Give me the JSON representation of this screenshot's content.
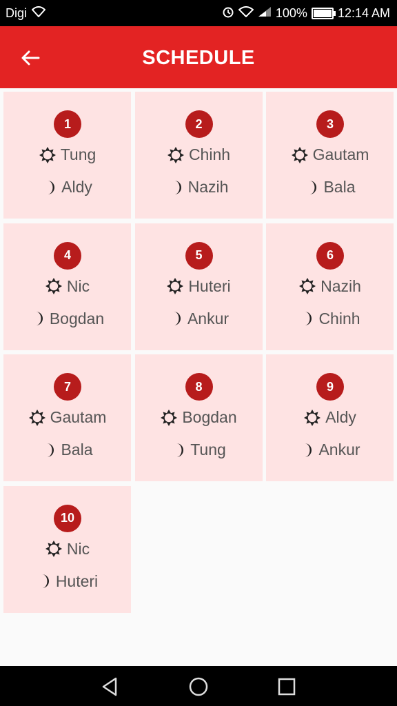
{
  "status_bar": {
    "carrier": "Digi",
    "battery": "100%",
    "time": "12:14 AM"
  },
  "header": {
    "title": "SCHEDULE",
    "back_icon": "arrow-left-icon"
  },
  "schedule": [
    {
      "number": "1",
      "day": "Tung",
      "night": "Aldy"
    },
    {
      "number": "2",
      "day": "Chinh",
      "night": "Nazih"
    },
    {
      "number": "3",
      "day": "Gautam",
      "night": "Bala"
    },
    {
      "number": "4",
      "day": "Nic",
      "night": "Bogdan"
    },
    {
      "number": "5",
      "day": "Huteri",
      "night": "Ankur"
    },
    {
      "number": "6",
      "day": "Nazih",
      "night": "Chinh"
    },
    {
      "number": "7",
      "day": "Gautam",
      "night": "Bala"
    },
    {
      "number": "8",
      "day": "Bogdan",
      "night": "Tung"
    },
    {
      "number": "9",
      "day": "Aldy",
      "night": "Ankur"
    },
    {
      "number": "10",
      "day": "Nic",
      "night": "Huteri"
    }
  ],
  "icons": {
    "day": "sun-icon",
    "night": "moon-icon"
  },
  "colors": {
    "app_bar": "#e32323",
    "badge": "#b71c1c",
    "cell_bg": "#fee3e3"
  },
  "nav": {
    "back": "nav-back-icon",
    "home": "nav-home-icon",
    "recents": "nav-recents-icon"
  }
}
